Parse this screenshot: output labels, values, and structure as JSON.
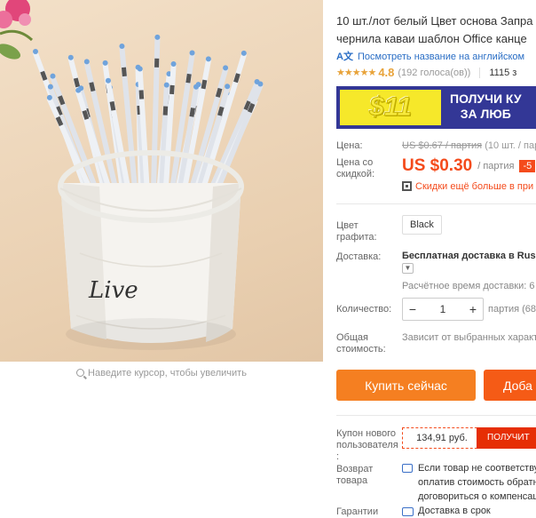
{
  "gallery": {
    "product_word": "Live",
    "zoom_hint": "Наведите курсор, чтобы увеличить"
  },
  "product": {
    "title_line1": "10 шт./лот белый Цвет основа Запра",
    "title_line2": "чернила каваи шаблон Office канце",
    "translate_link": "Посмотреть название на английском",
    "rating_value": "4.8",
    "rating_stars": 5,
    "votes": "(192 голоса(ов))",
    "orders": "1115 з"
  },
  "banner": {
    "amount": "$11",
    "line1": "ПОЛУЧИ КУ",
    "line2": "ЗА ЛЮБ"
  },
  "pricing": {
    "price_label": "Цена:",
    "old_price": "US $0.67 / партия",
    "old_price_extra": "(10 шт. / парт",
    "sale_label_line1": "Цена со",
    "sale_label_line2": "скидкой:",
    "sale_price": "US $0.30",
    "sale_unit": "/ партия",
    "discount": "-5",
    "promo": "Скидки ещё больше в при"
  },
  "options": {
    "color_label_line1": "Цвет",
    "color_label_line2": "графита:",
    "color_value": "Black",
    "shipping_label": "Доставка:",
    "shipping_value": "Бесплатная доставка в Russ",
    "shipping_time": "Расчётное время доставки: 6",
    "qty_label": "Количество:",
    "qty_minus": "−",
    "qty_value": "1",
    "qty_plus": "+",
    "qty_note": "партия (68",
    "total_label_line1": "Общая",
    "total_label_line2": "стоимость:",
    "total_value": "Зависит от выбранных характ"
  },
  "actions": {
    "buy_now": "Купить сейчас",
    "add_to_cart": "Доба"
  },
  "coupon": {
    "label_line1": "Купон нового",
    "label_line2": "пользователя",
    "label_line3": ":",
    "amount": "134,91 руб.",
    "button": "ПОЛУЧИТ"
  },
  "returns": {
    "label_line1": "Возврат",
    "label_line2": "товара",
    "text_line1": "Если товар не соответству",
    "text_line2": "оплатив стоимость обратн",
    "text_line3": "договориться о компенсац"
  },
  "guarantee": {
    "label": "Гарантии",
    "text": "Доставка в срок"
  },
  "colors": {
    "accent_orange": "#f57f21",
    "sale_red": "#f44b1c",
    "link_blue": "#2a6ec5",
    "banner_navy": "#333796",
    "banner_yellow": "#f6e82a"
  }
}
